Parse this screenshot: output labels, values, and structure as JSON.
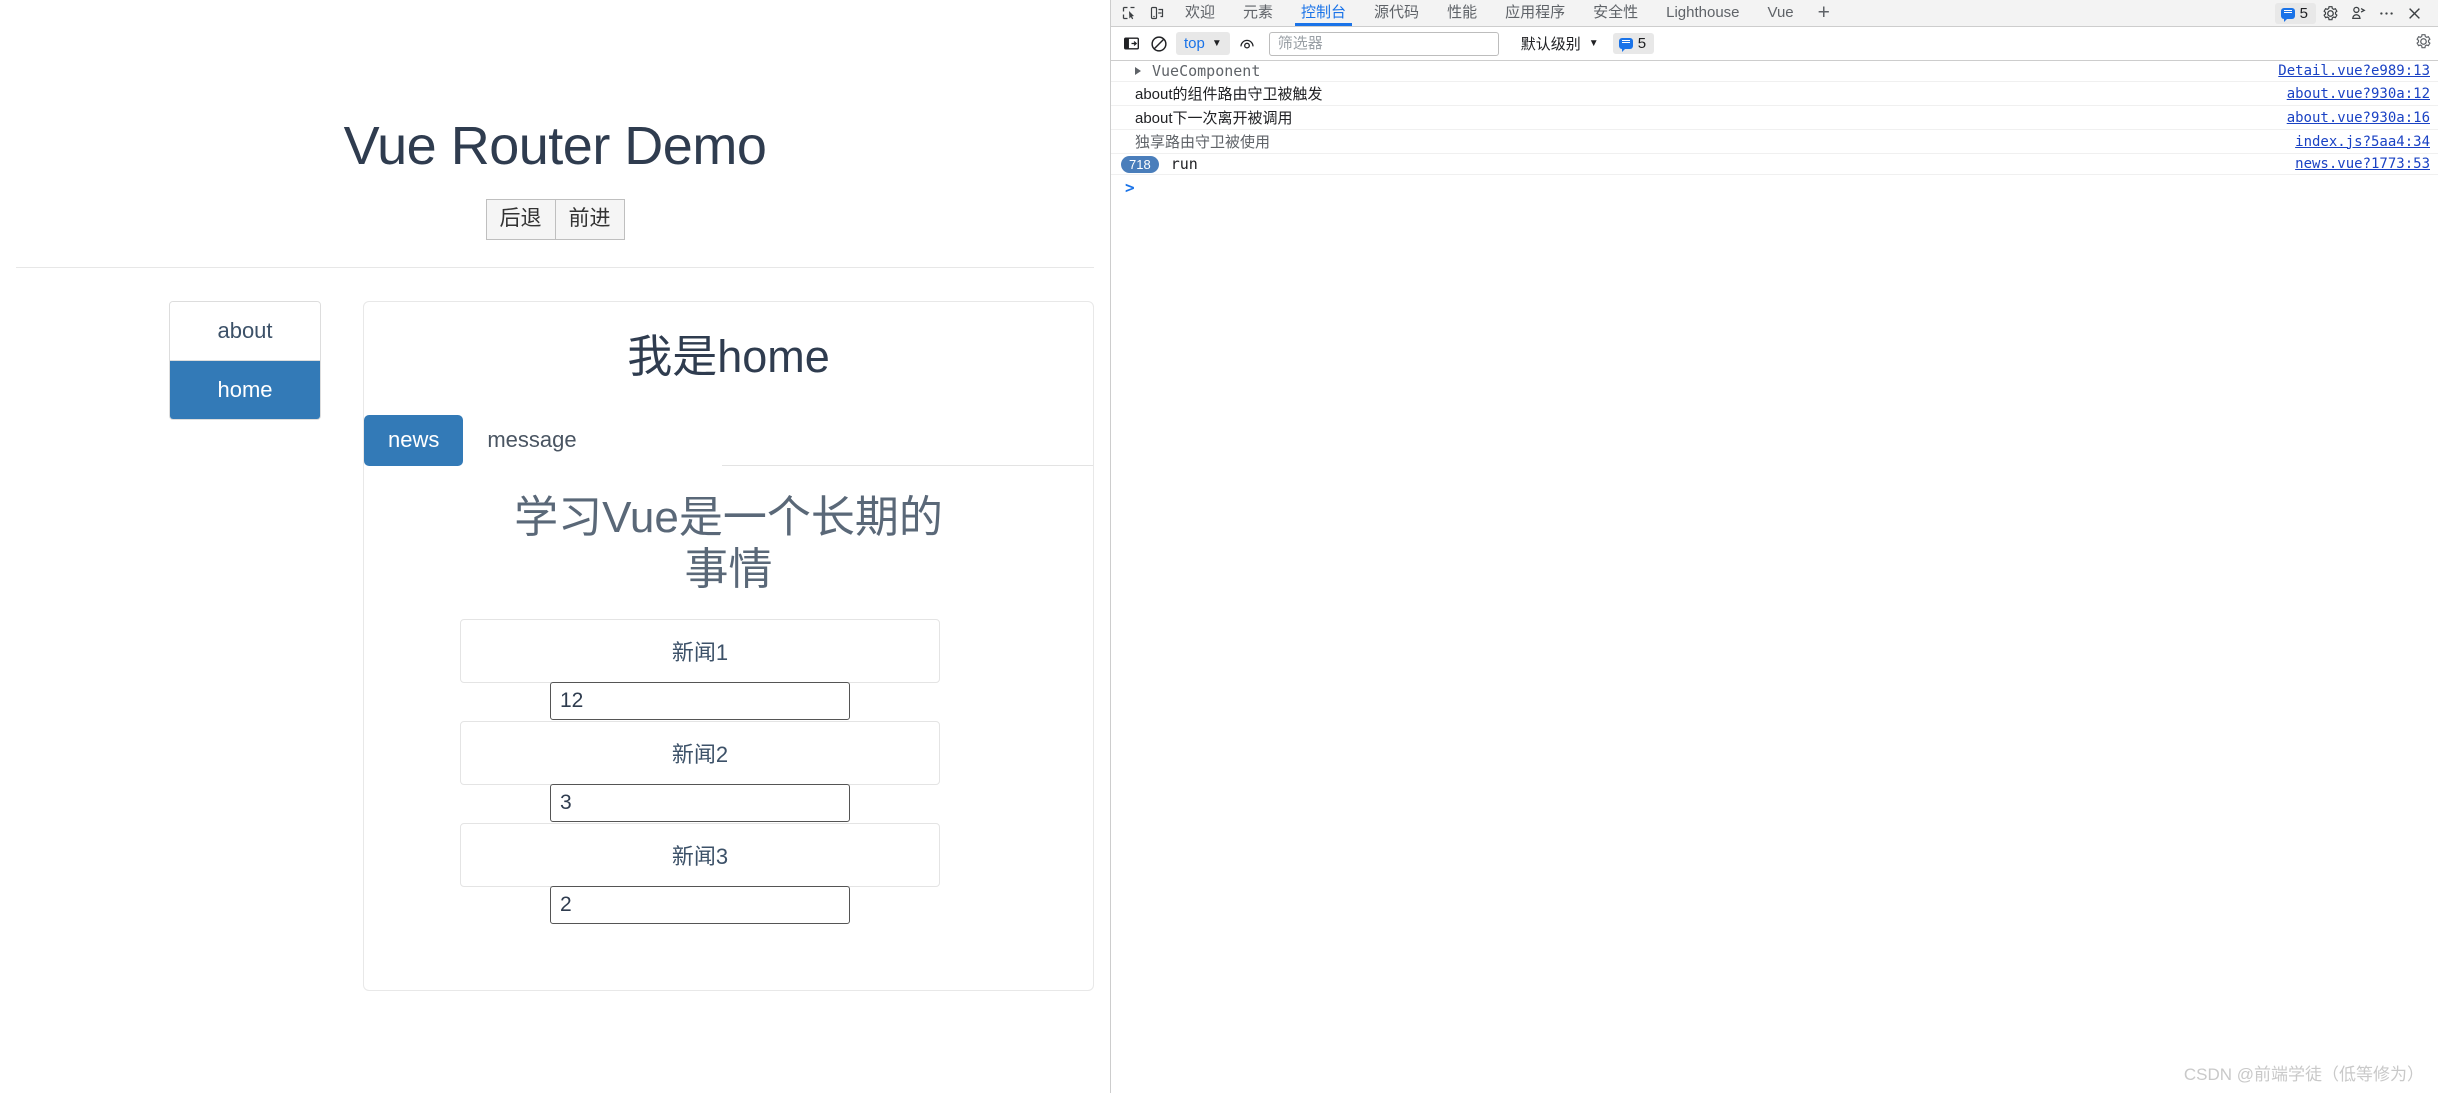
{
  "app": {
    "title": "Vue Router Demo",
    "nav_buttons": [
      {
        "label": "后退",
        "name": "back-button"
      },
      {
        "label": "前进",
        "name": "forward-button"
      }
    ],
    "sidebar": {
      "items": [
        {
          "label": "about",
          "active": false
        },
        {
          "label": "home",
          "active": true
        }
      ]
    },
    "content": {
      "heading": "我是home",
      "tabs": [
        {
          "label": "news",
          "active": true
        },
        {
          "label": "message",
          "active": false
        }
      ],
      "news_heading": "学习Vue是一个长期的事情",
      "news_items": [
        {
          "label": "新闻1",
          "input_value": "12"
        },
        {
          "label": "新闻2",
          "input_value": "3"
        },
        {
          "label": "新闻3",
          "input_value": "2"
        }
      ]
    },
    "colors": {
      "primary": "#337ab7",
      "heading": "#2f3c4f",
      "muted": "#5a6878"
    }
  },
  "devtools": {
    "tabs": [
      {
        "label": "欢迎",
        "active": false
      },
      {
        "label": "元素",
        "active": false
      },
      {
        "label": "控制台",
        "active": true
      },
      {
        "label": "源代码",
        "active": false
      },
      {
        "label": "性能",
        "active": false
      },
      {
        "label": "应用程序",
        "active": false
      },
      {
        "label": "安全性",
        "active": false
      },
      {
        "label": "Lighthouse",
        "active": false
      },
      {
        "label": "Vue",
        "active": false
      }
    ],
    "add_tab_label": "+",
    "message_count": "5",
    "filterbar": {
      "context": "top",
      "filter_placeholder": "筛选器",
      "filter_value": "",
      "level": "默认级别",
      "count_badge": "5"
    },
    "console_rows": [
      {
        "message": "VueComponent",
        "source": "Detail.vue?e989:13",
        "expandable": true,
        "mono": true,
        "count": null
      },
      {
        "message": "about的组件路由守卫被触发",
        "source": "about.vue?930a:12",
        "expandable": false,
        "mono": false,
        "count": null
      },
      {
        "message": "about下一次离开被调用",
        "source": "about.vue?930a:16",
        "expandable": false,
        "mono": false,
        "count": null
      },
      {
        "message": "独享路由守卫被使用",
        "source": "index.js?5aa4:34",
        "expandable": false,
        "mono": false,
        "count": null
      },
      {
        "message": "run",
        "source": "news.vue?1773:53",
        "expandable": false,
        "mono": true,
        "count": "718"
      }
    ],
    "prompt": ">",
    "accent": "#1a73e8"
  },
  "watermark": "CSDN @前端学徒（低等修为）"
}
